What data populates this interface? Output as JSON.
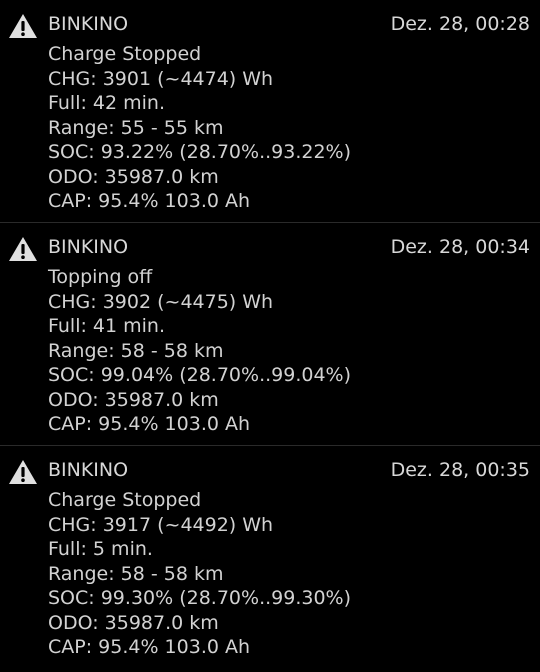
{
  "notifications": [
    {
      "icon": "warning-icon",
      "app": "BINKINO",
      "time": "Dez. 28, 00:28",
      "lines": [
        "Charge Stopped",
        "CHG: 3901 (~4474) Wh",
        "Full: 42 min.",
        "Range: 55 - 55 km",
        "SOC: 93.22% (28.70%..93.22%)",
        "ODO: 35987.0 km",
        "CAP: 95.4% 103.0 Ah"
      ]
    },
    {
      "icon": "warning-icon",
      "app": "BINKINO",
      "time": "Dez. 28, 00:34",
      "lines": [
        "Topping off",
        "CHG: 3902 (~4475) Wh",
        "Full: 41 min.",
        "Range: 58 - 58 km",
        "SOC: 99.04% (28.70%..99.04%)",
        "ODO: 35987.0 km",
        "CAP: 95.4% 103.0 Ah"
      ]
    },
    {
      "icon": "warning-icon",
      "app": "BINKINO",
      "time": "Dez. 28, 00:35",
      "lines": [
        "Charge Stopped",
        "CHG: 3917 (~4492) Wh",
        "Full: 5 min.",
        "Range: 58 - 58 km",
        "SOC: 99.30% (28.70%..99.30%)",
        "ODO: 35987.0 km",
        "CAP: 95.4% 103.0 Ah"
      ]
    }
  ],
  "colors": {
    "background": "#000000",
    "text": "#d6d6d6",
    "icon": "#e0e0e0"
  }
}
